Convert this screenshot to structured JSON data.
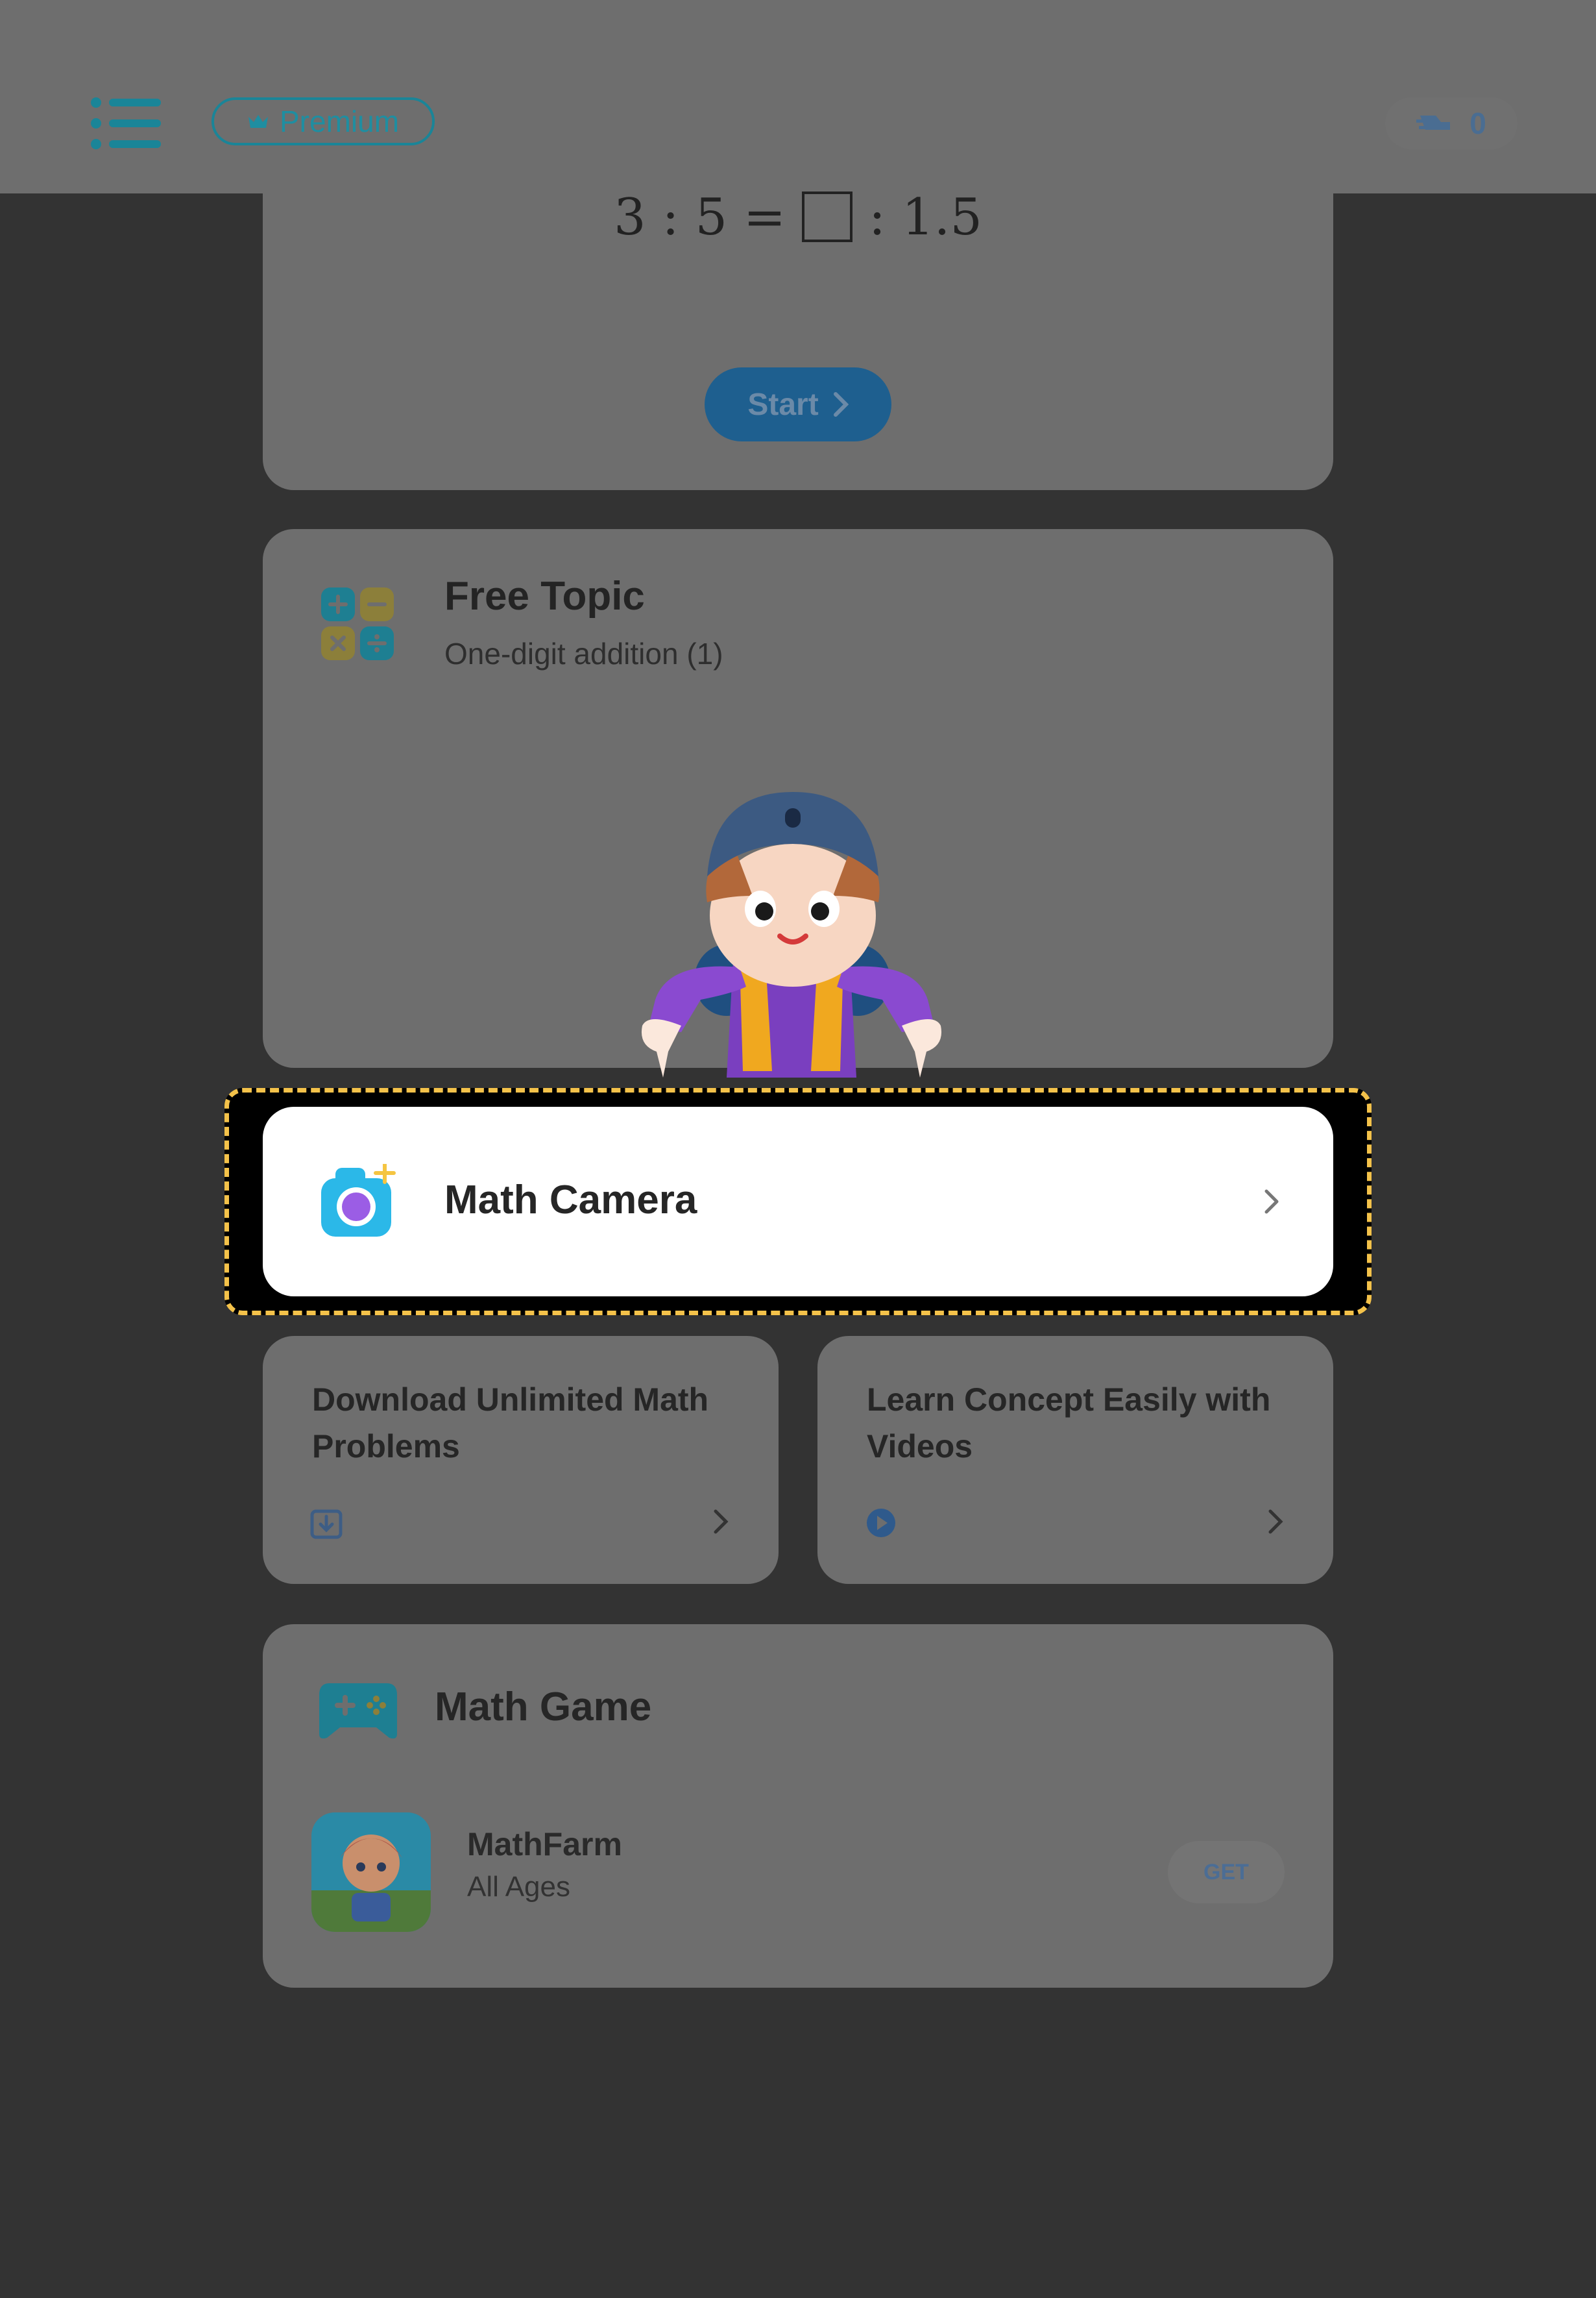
{
  "header": {
    "premium_label": "Premium",
    "xp_count": "0"
  },
  "quiz": {
    "formula_left": "3 : 5 =",
    "formula_right": ": 1.5",
    "start_label": "Start"
  },
  "free_topic": {
    "title": "Free Topic",
    "subtitle": "One-digit addition (1)"
  },
  "math_camera": {
    "label": "Math Camera"
  },
  "download": {
    "title": "Download Unlimited Math Problems"
  },
  "videos": {
    "title": "Learn Concept Easily with Videos"
  },
  "math_game": {
    "title": "Math Game",
    "app_name": "MathFarm",
    "app_sub": "All Ages",
    "get_label": "GET"
  },
  "colors": {
    "accent": "#1f8ea1",
    "highlight_border": "#f4c24a",
    "overlay": "#333333"
  }
}
